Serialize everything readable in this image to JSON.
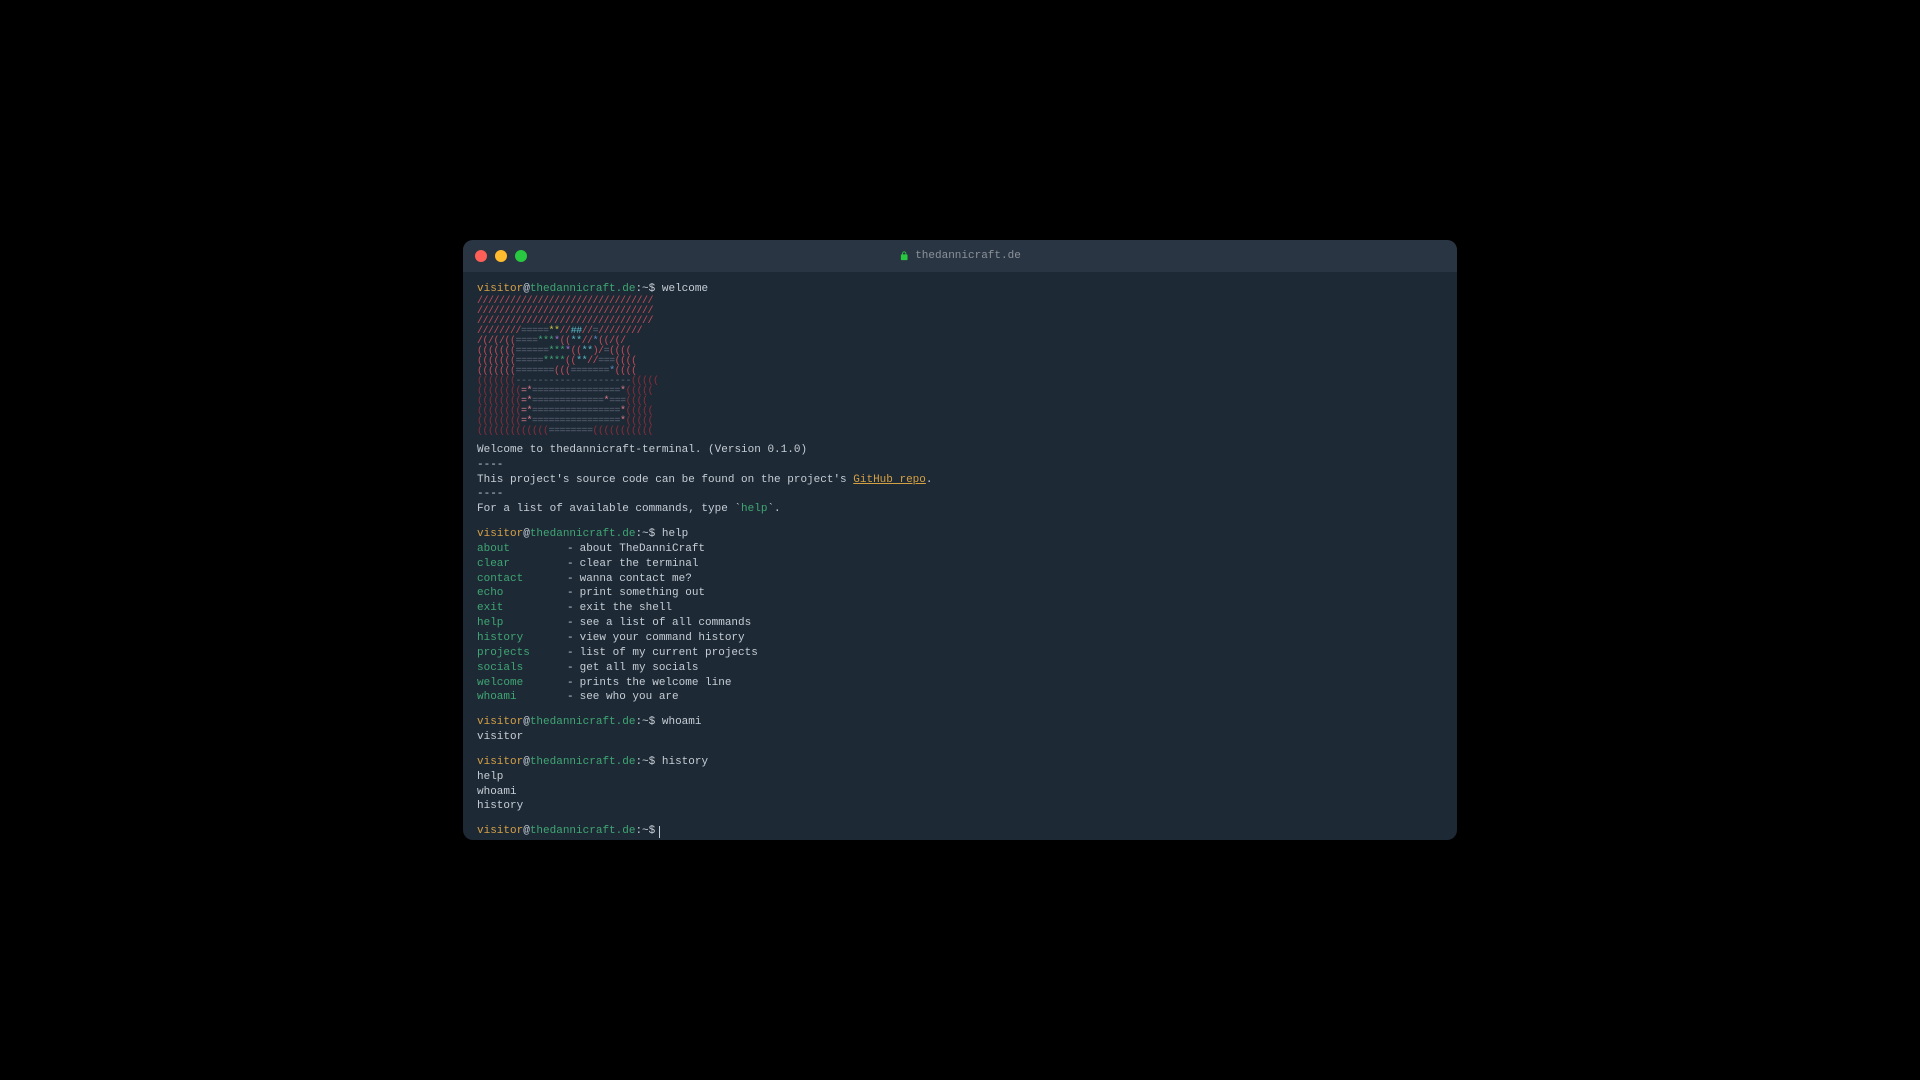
{
  "window": {
    "title": "thedannicraft.de"
  },
  "prompt": {
    "user": "visitor",
    "at": "@",
    "host": "thedannicraft.de",
    "path": ":~$"
  },
  "commands_run": {
    "welcome": "welcome",
    "help": "help",
    "whoami": "whoami",
    "history": "history"
  },
  "welcome_output": {
    "line1": "Welcome to thedannicraft-terminal. (Version 0.1.0)",
    "sep": "----",
    "line2_prefix": "This project's source code can be found on the project's ",
    "line2_link": "GitHub repo",
    "line2_suffix": ".",
    "line3_prefix": "For a list of available commands, type `",
    "line3_help": "help",
    "line3_suffix": "`."
  },
  "help_output": [
    {
      "cmd": "about",
      "desc": "about TheDanniCraft"
    },
    {
      "cmd": "clear",
      "desc": "clear the terminal"
    },
    {
      "cmd": "contact",
      "desc": "wanna contact me?"
    },
    {
      "cmd": "echo",
      "desc": "print something out"
    },
    {
      "cmd": "exit",
      "desc": "exit the shell"
    },
    {
      "cmd": "help",
      "desc": "see a list of all commands"
    },
    {
      "cmd": "history",
      "desc": "view your command history"
    },
    {
      "cmd": "projects",
      "desc": "list of my current projects"
    },
    {
      "cmd": "socials",
      "desc": "get all my socials"
    },
    {
      "cmd": "welcome",
      "desc": "prints the welcome line"
    },
    {
      "cmd": "whoami",
      "desc": "see who you are"
    }
  ],
  "whoami_output": "visitor",
  "history_output": [
    "help",
    "whoami",
    "history"
  ],
  "colors": {
    "bg": "#1e2936",
    "titlebar": "#2a3543",
    "text": "#c5ced6",
    "user": "#d4a044",
    "host": "#3fa672",
    "link": "#d4a044",
    "cmd": "#3fa672"
  }
}
